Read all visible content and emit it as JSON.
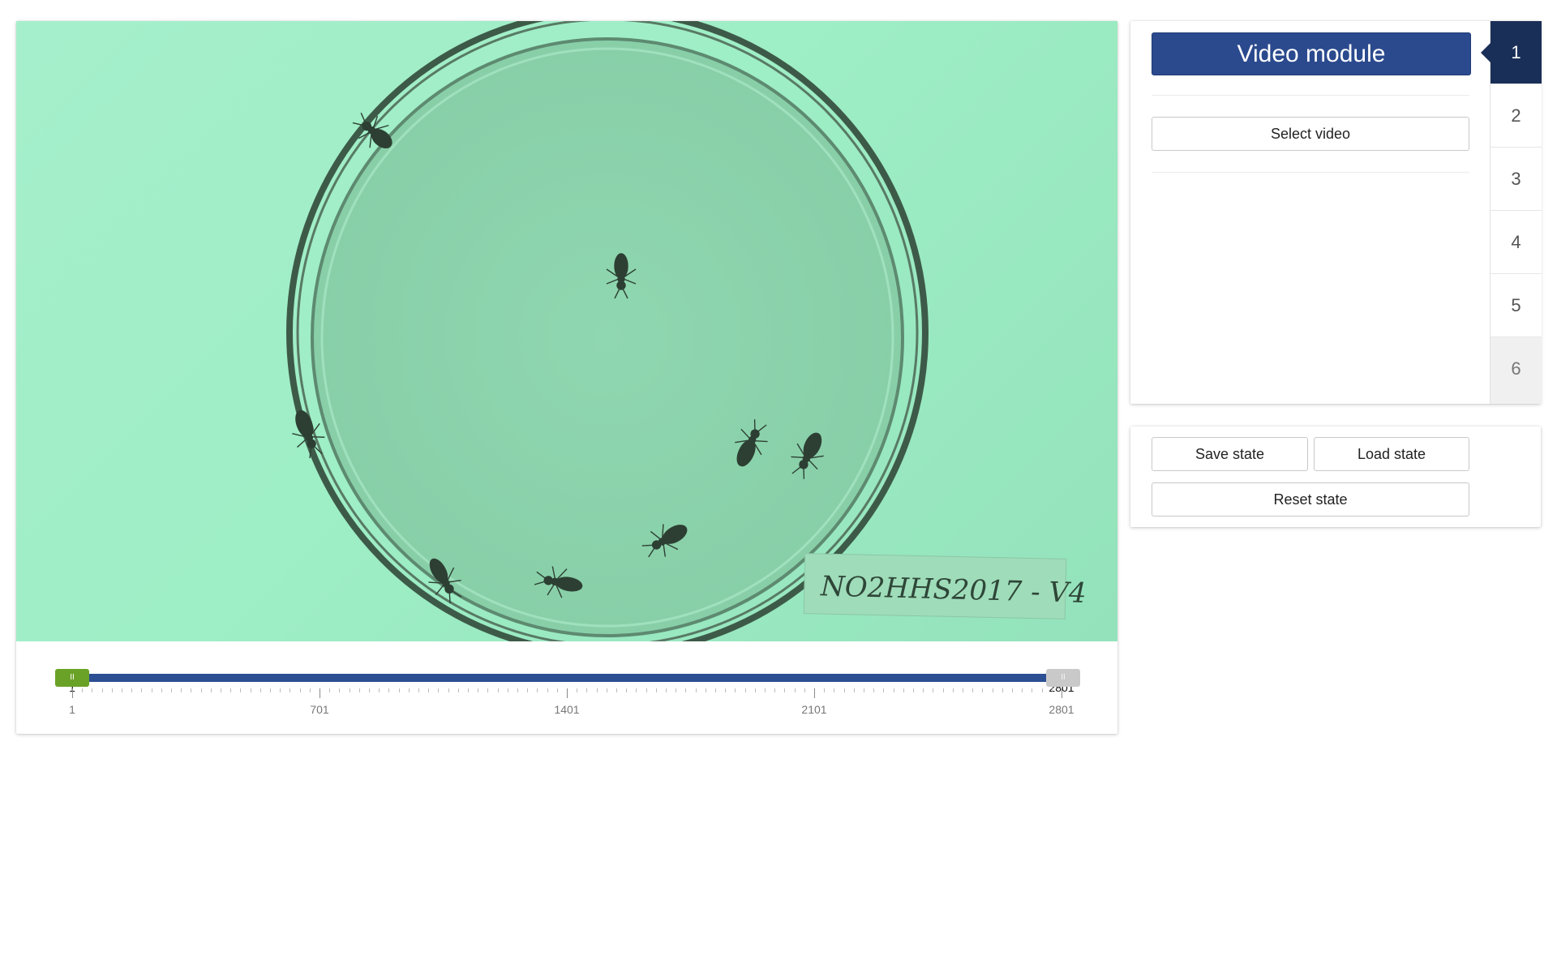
{
  "video": {
    "frame_label_text": "NO2HHS2017 - V4",
    "background_color": "#a4eecb",
    "dish_ring_color": "#3d5a48"
  },
  "slider": {
    "min_label": "1",
    "max_label": "2801",
    "start_value": 1,
    "end_value": 2801,
    "handle_glyph": "II",
    "tick_labels": [
      "1",
      "701",
      "1401",
      "2101",
      "2801"
    ],
    "track_color": "#2c4f93",
    "start_handle_color": "#6aa227"
  },
  "module": {
    "title": "Video module",
    "select_video_label": "Select video",
    "steps": [
      "1",
      "2",
      "3",
      "4",
      "5",
      "6"
    ],
    "active_step": "1"
  },
  "state": {
    "save_label": "Save state",
    "load_label": "Load state",
    "reset_label": "Reset state"
  }
}
